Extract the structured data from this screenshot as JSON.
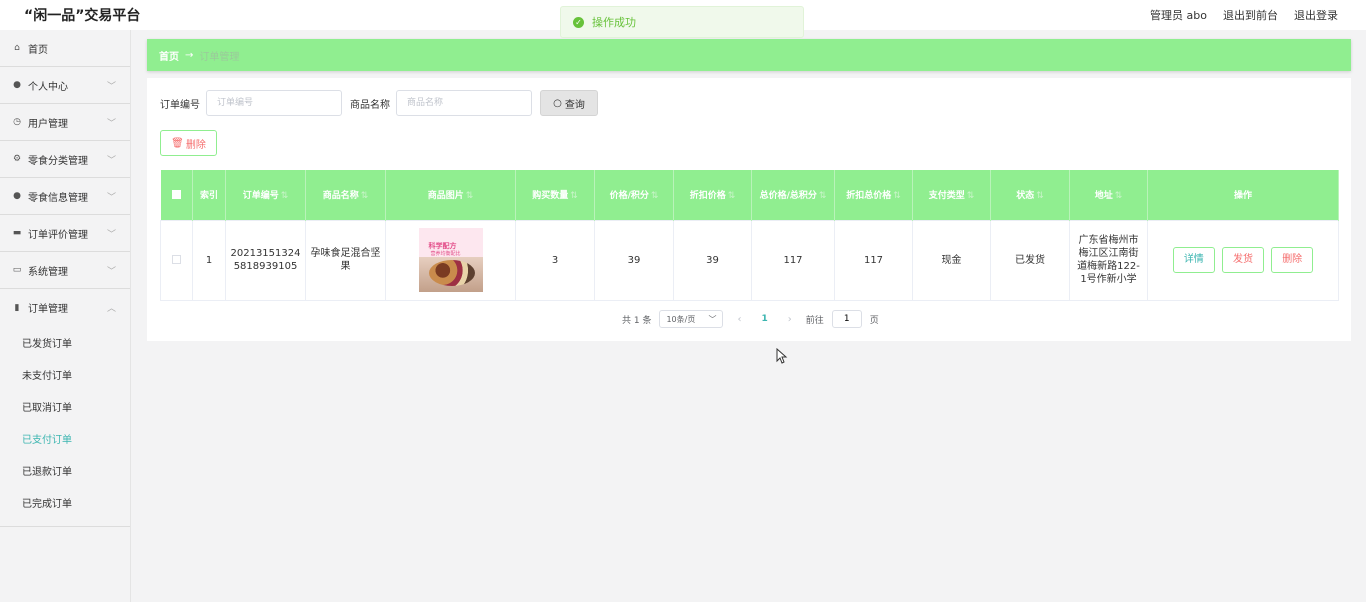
{
  "header": {
    "brand": "“闲一品”交易平台",
    "user": "管理员 abo",
    "back_front": "退出到前台",
    "logout": "退出登录"
  },
  "toast": {
    "message": "操作成功"
  },
  "sidebar": {
    "items": [
      {
        "label": "首页",
        "icon": "home-icon"
      },
      {
        "label": "个人中心",
        "icon": "user-icon"
      },
      {
        "label": "用户管理",
        "icon": "clock-icon"
      },
      {
        "label": "零食分类管理",
        "icon": "gear-icon"
      },
      {
        "label": "零食信息管理",
        "icon": "user-icon"
      },
      {
        "label": "订单评价管理",
        "icon": "comment-icon"
      },
      {
        "label": "系统管理",
        "icon": "monitor-icon"
      },
      {
        "label": "订单管理",
        "icon": "bar-chart-icon"
      }
    ],
    "sub_items": [
      "已发货订单",
      "未支付订单",
      "已取消订单",
      "已支付订单",
      "已退款订单",
      "已完成订单"
    ],
    "active_sub": "已支付订单"
  },
  "breadcrumb": {
    "home": "首页",
    "arrow": "→",
    "current": "订单管理"
  },
  "search": {
    "order_label": "订单编号",
    "order_placeholder": "订单编号",
    "name_label": "商品名称",
    "name_placeholder": "商品名称",
    "query_label": "查询"
  },
  "toolbar": {
    "delete_label": "删除"
  },
  "table": {
    "headers": [
      "索引",
      "订单编号",
      "商品名称",
      "商品图片",
      "购买数量",
      "价格/积分",
      "折扣价格",
      "总价格/总积分",
      "折扣总价格",
      "支付类型",
      "状态",
      "地址",
      "操作"
    ],
    "rows": [
      {
        "index": "1",
        "order_no": "202131513245818939105",
        "name": "孕味食足混合坚果",
        "image_text_1": "科学配方",
        "image_text_2": "营养均衡配比",
        "qty": "3",
        "price": "39",
        "discount_price": "39",
        "total": "117",
        "discount_total": "117",
        "pay_type": "现金",
        "status": "已发货",
        "address": "广东省梅州市梅江区江南街道梅新路122-1号作新小学"
      }
    ],
    "actions": {
      "detail": "详情",
      "ship": "发货",
      "delete": "删除"
    }
  },
  "pagination": {
    "total": "共 1 条",
    "page_size": "10条/页",
    "current": "1",
    "goto": "前往",
    "goto_value": "1",
    "page_unit": "页"
  },
  "colors": {
    "accent_green": "#90ee90",
    "teal": "#3bb5b0",
    "danger": "#f56c6c"
  }
}
